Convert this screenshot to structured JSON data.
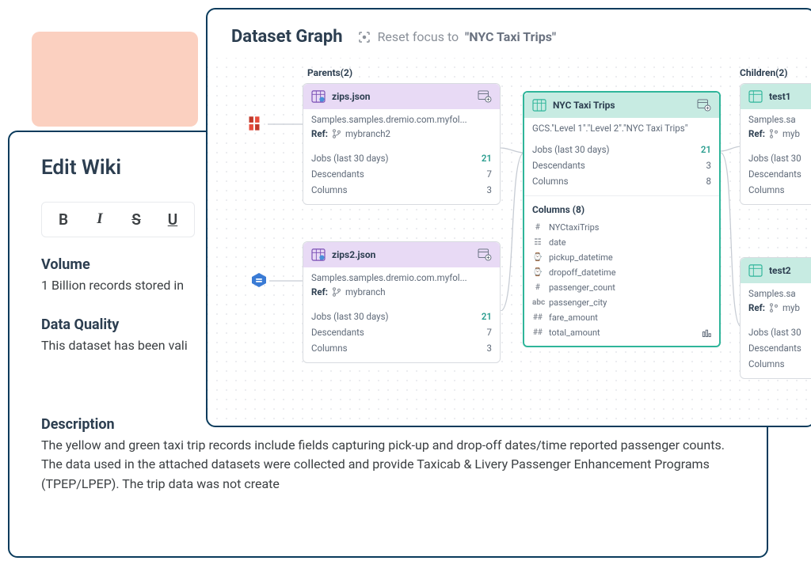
{
  "wiki": {
    "title": "Edit Wiki",
    "toolbar": {
      "bold": "B",
      "italic": "I",
      "strike": "S",
      "underline": "U"
    },
    "sections": {
      "volume": {
        "heading": "Volume",
        "body": "1 Billion records stored in"
      },
      "quality": {
        "heading": "Data Quality",
        "body": "This dataset has been vali"
      },
      "description": {
        "heading": "Description",
        "body": "The yellow and green taxi trip records include fields capturing pick-up and drop-off dates/time reported passenger counts. The data used in the attached datasets were collected and provide Taxicab & Livery Passenger Enhancement Programs (TPEP/LPEP). The trip data was not create"
      }
    }
  },
  "graph": {
    "title": "Dataset Graph",
    "reset": {
      "prefix": "Reset focus to ",
      "quoted": "\"NYC Taxi Trips\""
    },
    "parents_label": "Parents(2)",
    "children_label": "Children(2)",
    "parents": [
      {
        "name": "zips.json",
        "path": "Samples.samples.dremio.com.myfol...",
        "ref_label": "Ref:",
        "branch": "mybranch2",
        "jobs_label": "Jobs (last 30 days)",
        "jobs": "21",
        "desc_label": "Descendants",
        "desc": "7",
        "cols_label": "Columns",
        "cols": "3"
      },
      {
        "name": "zips2.json",
        "path": "Samples.samples.dremio.com.myfol...",
        "ref_label": "Ref:",
        "branch": "mybranch",
        "jobs_label": "Jobs (last 30 days)",
        "jobs": "21",
        "desc_label": "Descendants",
        "desc": "7",
        "cols_label": "Columns",
        "cols": "3"
      }
    ],
    "focus": {
      "name": "NYC Taxi Trips",
      "path": "GCS.\"Level 1\".\"Level 2\".\"NYC Taxi Trips\"",
      "jobs_label": "Jobs (last 30 days)",
      "jobs": "21",
      "desc_label": "Descendants",
      "desc": "3",
      "cols_label": "Columns",
      "cols": "8",
      "columns_heading": "Columns (8)",
      "columns": [
        {
          "type": "#",
          "name": "NYCtaxiTrips"
        },
        {
          "type": "date",
          "name": "date"
        },
        {
          "type": "datetime",
          "name": "pickup_datetime"
        },
        {
          "type": "datetime",
          "name": "dropoff_datetime"
        },
        {
          "type": "#",
          "name": "passenger_count"
        },
        {
          "type": "abc",
          "name": "passenger_city"
        },
        {
          "type": "##",
          "name": "fare_amount"
        },
        {
          "type": "##",
          "name": "total_amount"
        }
      ]
    },
    "children": [
      {
        "name": "test1",
        "path": "Samples.sa",
        "ref_label": "Ref:",
        "branch": "myb",
        "jobs_label": "Jobs (last 30",
        "desc_label": "Descendants",
        "cols_label": "Columns"
      },
      {
        "name": "test2",
        "path": "Samples.sa",
        "ref_label": "Ref:",
        "branch": "myb",
        "jobs_label": "Jobs (last 30",
        "desc_label": "Descendants",
        "cols_label": "Columns"
      }
    ]
  }
}
